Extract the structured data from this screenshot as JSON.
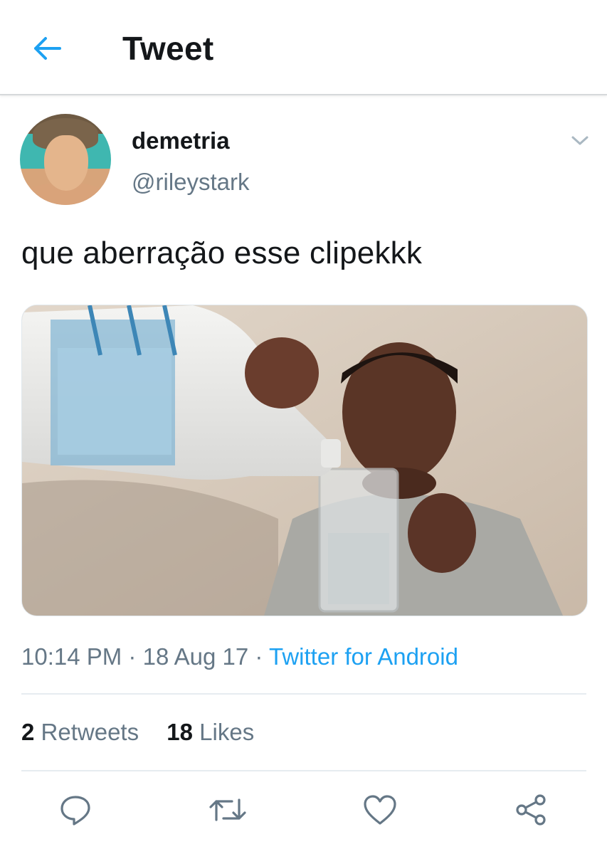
{
  "header": {
    "title": "Tweet",
    "back_icon": "arrow-left-icon"
  },
  "user": {
    "display_name": "demetria",
    "handle": "@rileystark",
    "menu_icon": "chevron-down-icon"
  },
  "tweet": {
    "text": "que aberração esse clipekkk",
    "media_description": "photo-meme",
    "time": "10:14 PM",
    "separator": "·",
    "date": "18 Aug 17",
    "source": "Twitter for Android"
  },
  "stats": {
    "retweets_count": "2",
    "retweets_label": "Retweets",
    "likes_count": "18",
    "likes_label": "Likes"
  },
  "actions": [
    "reply-icon",
    "retweet-icon",
    "like-icon",
    "share-icon"
  ],
  "colors": {
    "accent": "#1da1f2",
    "secondary_text": "#657786",
    "primary_text": "#14171a",
    "divider": "#e6ecf0"
  }
}
